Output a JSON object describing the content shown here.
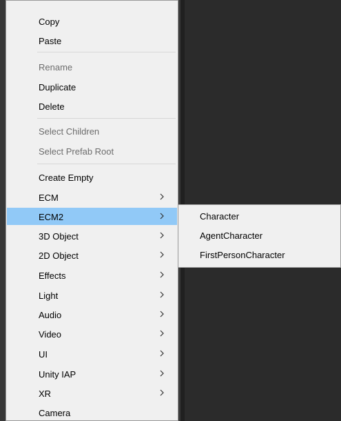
{
  "menu": {
    "group1": [
      "Copy",
      "Paste"
    ],
    "group2": [
      "Rename",
      "Duplicate",
      "Delete"
    ],
    "group3": [
      "Select Children",
      "Select Prefab Root"
    ],
    "group4": [
      "Create Empty",
      "ECM",
      "ECM2",
      "3D Object",
      "2D Object",
      "Effects",
      "Light",
      "Audio",
      "Video",
      "UI",
      "Unity IAP",
      "XR",
      "Camera"
    ]
  },
  "submenu": {
    "items": [
      "Character",
      "AgentCharacter",
      "FirstPersonCharacter"
    ]
  },
  "colors": {
    "menu_bg": "#f0f0f0",
    "highlight": "#91c9f7",
    "disabled_text": "#6d6d6d",
    "background_dark": "#2b2b2b"
  }
}
